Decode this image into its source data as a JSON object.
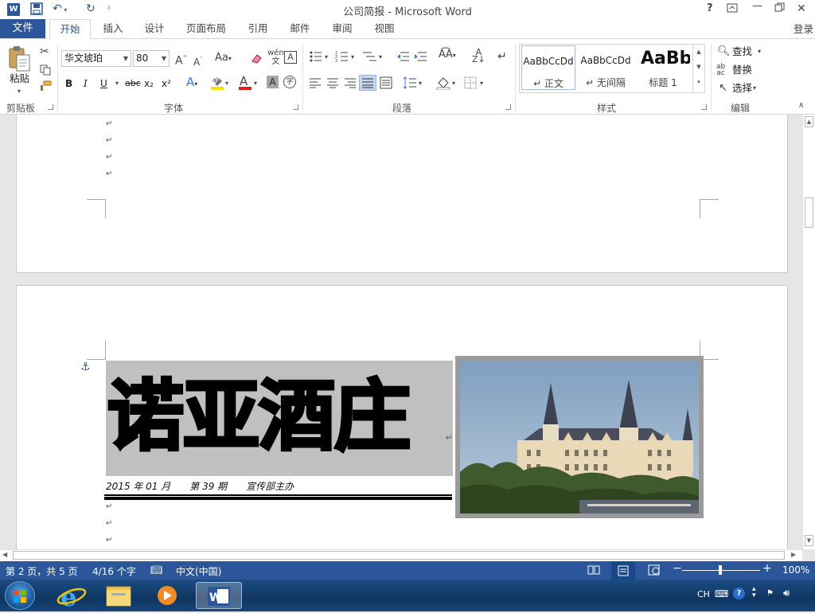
{
  "window": {
    "title": "公司简报 - Microsoft Word",
    "help": "?",
    "controls": [
      "?",
      "⧉",
      "—",
      "▢",
      "✕"
    ]
  },
  "tabs": {
    "file": "文件",
    "items": [
      "开始",
      "插入",
      "设计",
      "页面布局",
      "引用",
      "邮件",
      "审阅",
      "视图"
    ],
    "active": "开始",
    "login": "登录"
  },
  "ribbon": {
    "clipboard": {
      "label": "剪贴板",
      "paste": "粘贴"
    },
    "font": {
      "label": "字体",
      "name": "华文琥珀",
      "size": "80",
      "bold": "B",
      "italic": "I",
      "underline": "U",
      "strike": "abc",
      "sub": "x₂",
      "sup": "x²"
    },
    "paragraph": {
      "label": "段落"
    },
    "styles": {
      "label": "样式",
      "items": [
        {
          "sample": "AaBbCcDd",
          "name": "↵ 正文"
        },
        {
          "sample": "AaBbCcDd",
          "name": "↵ 无间隔"
        },
        {
          "sample": "AaBb",
          "name": "标题 1"
        }
      ]
    },
    "editing": {
      "label": "编辑",
      "find": "查找",
      "replace": "替换",
      "select": "选择"
    }
  },
  "document": {
    "headline": "诺亚酒庄",
    "issue_line": "2015 年 01 月　　第 39 期　　宣传部主办",
    "para_mark": "↵"
  },
  "status": {
    "page": "第 2 页，共 5 页",
    "words": "4/16 个字",
    "language": "中文(中国)",
    "zoom": "100%"
  },
  "taskbar": {
    "ime": "CH"
  },
  "colors": {
    "accent": "#2b579a",
    "headline_bg": "#c0c0c0",
    "photo_frame": "#9b9b9b"
  }
}
